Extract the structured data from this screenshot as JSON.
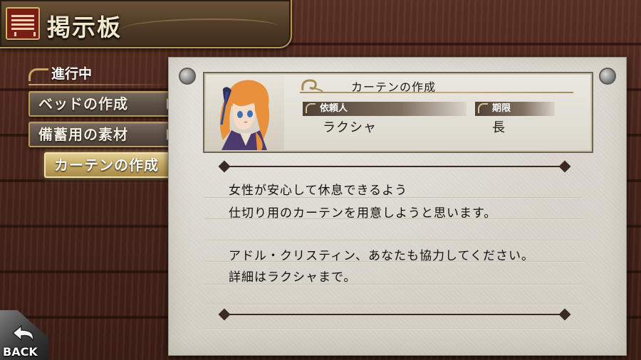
{
  "header": {
    "title": "掲示板",
    "icon": "notice-board-icon"
  },
  "sidebar": {
    "section_label": "進行中",
    "quests": [
      {
        "label": "ベッドの作成",
        "selected": false
      },
      {
        "label": "備蓄用の素材",
        "selected": false
      },
      {
        "label": "カーテンの作成",
        "selected": true
      }
    ]
  },
  "detail": {
    "title": "カーテンの作成",
    "client_label": "依頼人",
    "client": "ラクシャ",
    "deadline_label": "期限",
    "deadline": "長",
    "body_lines": [
      "女性が安心して休息できるよう",
      "仕切り用のカーテンを用意しようと思います。",
      "",
      "アドル・クリスティン、あなたも協力してください。",
      "詳細はラクシャまで。"
    ]
  },
  "footer": {
    "back_label": "BACK"
  },
  "colors": {
    "wood": "#4a261c",
    "parchment": "#d8d4ca",
    "gold": "#c7a765",
    "selected_button": "#c9ad68"
  }
}
